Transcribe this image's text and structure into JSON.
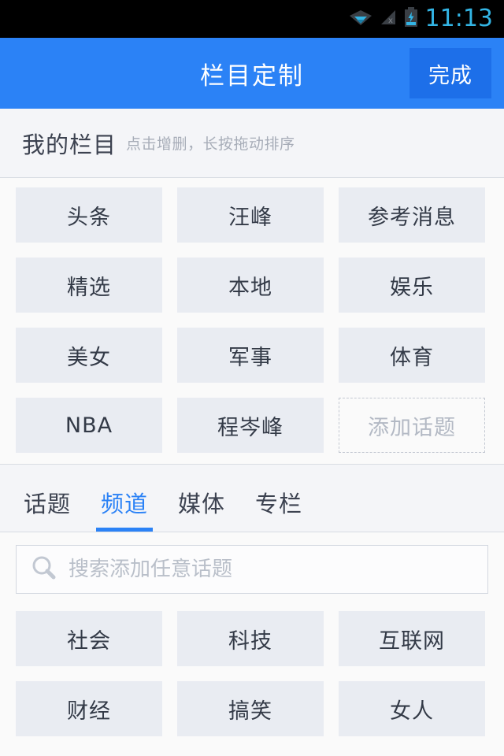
{
  "statusbar": {
    "time": "11:13",
    "icons": [
      "wifi-icon",
      "signal-off-icon",
      "battery-charging-icon"
    ]
  },
  "header": {
    "title": "栏目定制",
    "done_label": "完成",
    "bg_color": "#2b82f6",
    "button_color": "#1d6fe9"
  },
  "my_columns": {
    "title": "我的栏目",
    "subtitle": "点击增删，长按拖动排序",
    "tiles": [
      "头条",
      "汪峰",
      "参考消息",
      "精选",
      "本地",
      "娱乐",
      "美女",
      "军事",
      "体育",
      "NBA",
      "程岑峰"
    ],
    "add_label": "添加话题"
  },
  "tabs": {
    "items": [
      {
        "label": "话题",
        "active": false
      },
      {
        "label": "频道",
        "active": true
      },
      {
        "label": "媒体",
        "active": false
      },
      {
        "label": "专栏",
        "active": false
      }
    ],
    "active_color": "#2b82f6"
  },
  "search": {
    "placeholder": "搜索添加任意话题",
    "value": "",
    "icon": "search-icon"
  },
  "available": {
    "tiles": [
      "社会",
      "科技",
      "互联网",
      "财经",
      "搞笑",
      "女人"
    ]
  }
}
